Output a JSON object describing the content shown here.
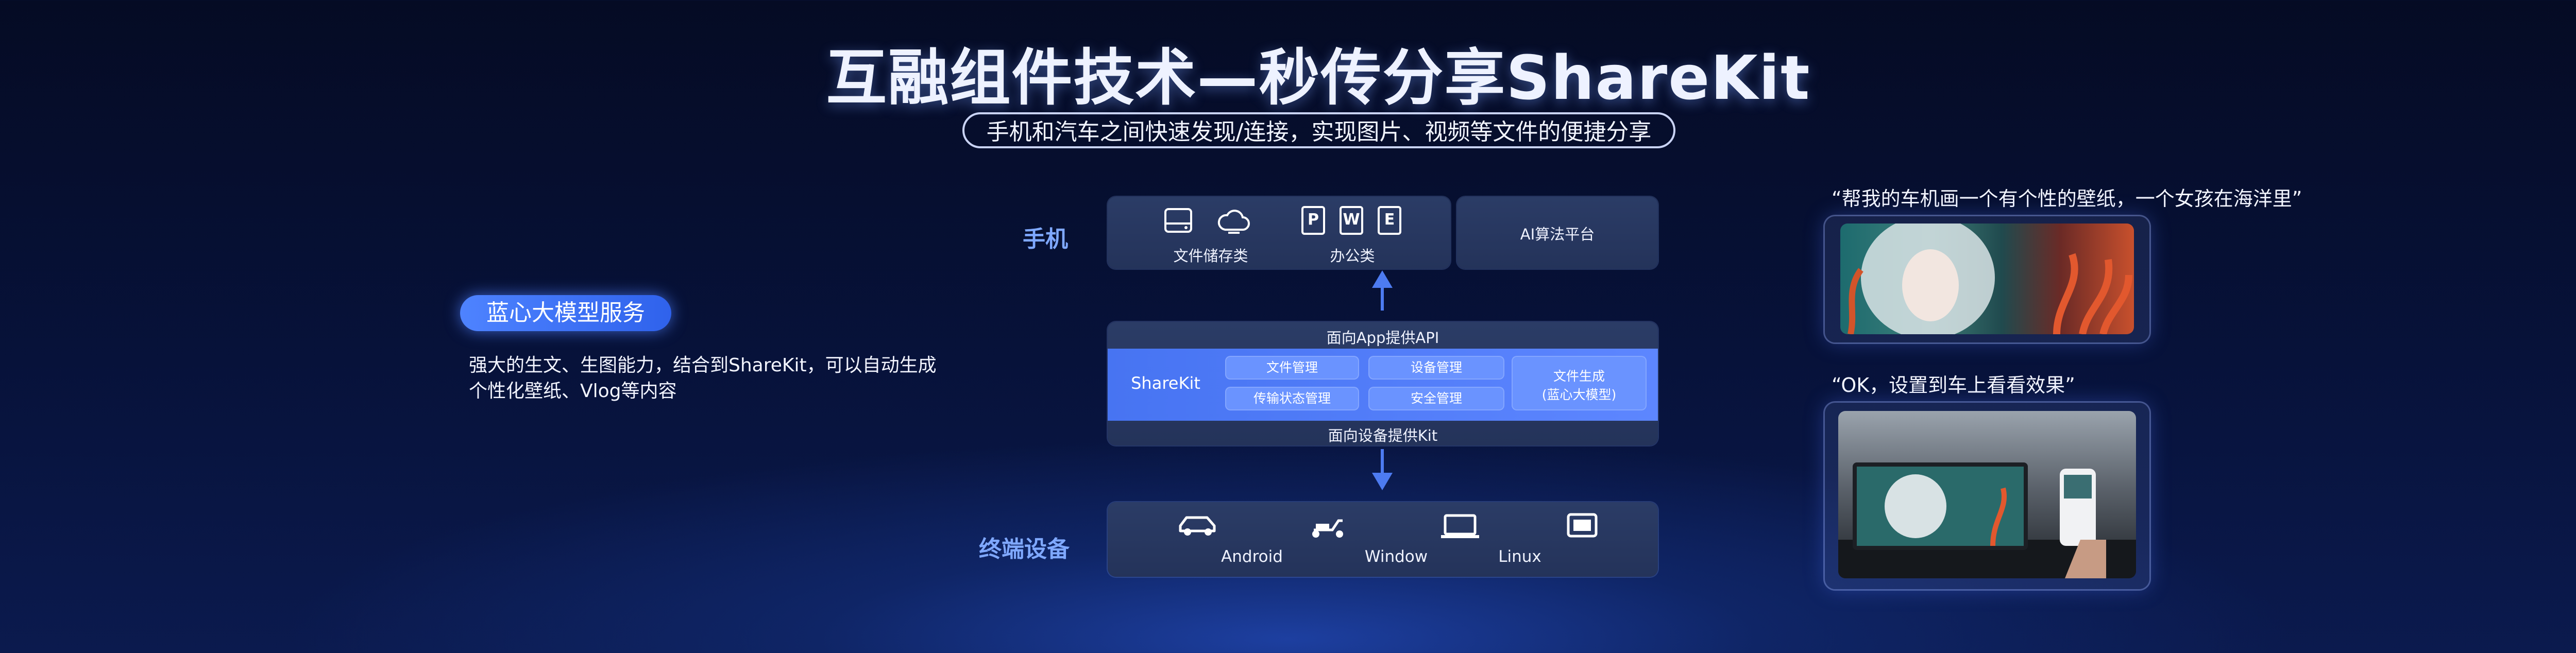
{
  "title": "互融组件技术—秒传分享ShareKit",
  "subtitle": "手机和汽车之间快速发现/连接，实现图片、视频等文件的便捷分享",
  "phone_row": {
    "label": "手机",
    "file_storage": "文件储存类",
    "office": "办公类",
    "ai_platform": "AI算法平台",
    "doc_icons": [
      "P",
      "W",
      "E"
    ]
  },
  "sharekit_block": {
    "top_label": "面向App提供API",
    "name": "ShareKit",
    "modules": [
      "文件管理",
      "设备管理",
      "传输状态管理",
      "安全管理"
    ],
    "gen_line1": "文件生成",
    "gen_line2": "(蓝心大模型)",
    "bottom_label": "面向设备提供Kit"
  },
  "devices_row": {
    "label": "终端设备",
    "android": "Android",
    "window": "Window",
    "linux": "Linux"
  },
  "service": {
    "pill": "蓝心大模型服务",
    "desc_line1": "强大的生文、生图能力，结合到ShareKit，可以自动生成",
    "desc_line2": "个性化壁纸、Vlog等内容"
  },
  "quotes": {
    "q1": "“帮我的车机画一个有个性的壁纸，一个女孩在海洋里”",
    "q2": "“OK，设置到车上看看效果”"
  },
  "colors": {
    "accent": "#4d7bf0",
    "label_blue": "#7fa8ff",
    "panel": "#2b3c66",
    "chip": "#6a93ff"
  }
}
